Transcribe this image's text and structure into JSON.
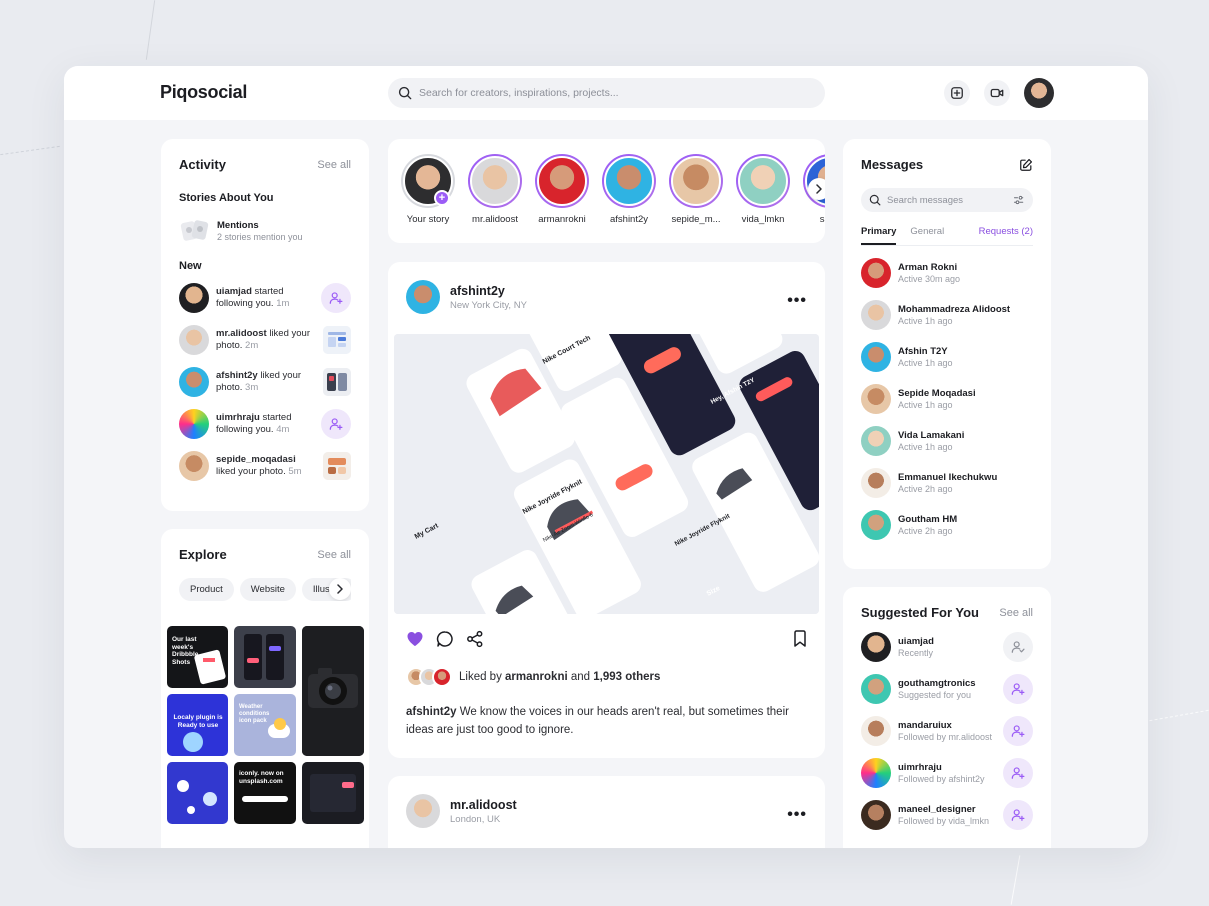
{
  "brand": "Piqosocial",
  "search": {
    "placeholder": "Search for creators, inspirations, projects..."
  },
  "activity": {
    "title": "Activity",
    "see_all": "See all",
    "stories_title": "Stories About You",
    "mention_name": "Mentions",
    "mention_desc": "2 stories mention you",
    "new_title": "New",
    "items": [
      {
        "user": "uiamjad",
        "action": " started following you.",
        "time": " 1m"
      },
      {
        "user": "mr.alidoost",
        "action": " liked your photo.",
        "time": " 2m"
      },
      {
        "user": "afshint2y",
        "action": " liked your photo.",
        "time": " 3m"
      },
      {
        "user": "uimrhraju",
        "action": " started following you.",
        "time": " 4m"
      },
      {
        "user": "sepide_moqadasi",
        "action": " liked your photo.",
        "time": " 5m"
      }
    ]
  },
  "explore": {
    "title": "Explore",
    "see_all": "See all",
    "chips": [
      "Product",
      "Website",
      "Illustrati"
    ],
    "tiles": [
      {
        "text": "Our last week's Dribbble Shots"
      },
      {
        "text": ""
      },
      {
        "text": ""
      },
      {
        "text": "Localy plugin is Ready to use"
      },
      {
        "text": "Weather conditions icon pack"
      },
      {
        "text": ""
      },
      {
        "text": ""
      },
      {
        "text": "iconly. now on unsplash.com"
      },
      {
        "text": ""
      }
    ]
  },
  "stories": [
    {
      "label": "Your story"
    },
    {
      "label": "mr.alidoost"
    },
    {
      "label": "armanrokni"
    },
    {
      "label": "afshint2y"
    },
    {
      "label": "sepide_m..."
    },
    {
      "label": "vida_lmkn"
    },
    {
      "label": "sadh"
    }
  ],
  "post": {
    "user": "afshint2y",
    "location": "New York City, NY",
    "liked_prefix": "Liked by ",
    "liked_user": "armanrokni",
    "liked_mid": " and ",
    "liked_count": "1,993 others",
    "caption_user": "afshint2y",
    "caption_text": " We know the voices in our heads aren't real, but sometimes their ideas are just too good to ignore.",
    "image": {
      "screens": [
        {
          "text": "Nike Court Tech"
        },
        {
          "text": "My Cart"
        },
        {
          "text": "Nike Joyride Flyknit"
        },
        {
          "text": "Nike Air Zoom Winflo 6"
        },
        {
          "text": "Hey, Afshin T2Y"
        },
        {
          "text": "Nike Joyride Flyknit"
        },
        {
          "text": "Size"
        }
      ]
    }
  },
  "post2": {
    "user": "mr.alidoost",
    "location": "London, UK"
  },
  "messages": {
    "title": "Messages",
    "search_placeholder": "Search messages",
    "tabs": {
      "primary": "Primary",
      "general": "General",
      "requests": "Requests (2)"
    },
    "items": [
      {
        "name": "Arman Rokni",
        "status": "Active 30m ago"
      },
      {
        "name": "Mohammadreza Alidoost",
        "status": "Active 1h ago"
      },
      {
        "name": "Afshin T2Y",
        "status": "Active 1h ago"
      },
      {
        "name": "Sepide Moqadasi",
        "status": "Active 1h ago"
      },
      {
        "name": "Vida Lamakani",
        "status": "Active 1h ago"
      },
      {
        "name": "Emmanuel Ikechukwu",
        "status": "Active 2h ago"
      },
      {
        "name": "Goutham HM",
        "status": "Active 2h ago"
      }
    ]
  },
  "suggested": {
    "title": "Suggested For You",
    "see_all": "See all",
    "items": [
      {
        "name": "uiamjad",
        "status": "Recently"
      },
      {
        "name": "gouthamgtronics",
        "status": "Suggested for you"
      },
      {
        "name": "mandaruiux",
        "status": "Followed by mr.alidoost"
      },
      {
        "name": "uimrhraju",
        "status": "Followed by afshint2y"
      },
      {
        "name": "maneel_designer",
        "status": "Followed by vida_lmkn"
      }
    ]
  },
  "colors": {
    "accent": "#9b5cf6",
    "bg": "#f4f5f8"
  }
}
